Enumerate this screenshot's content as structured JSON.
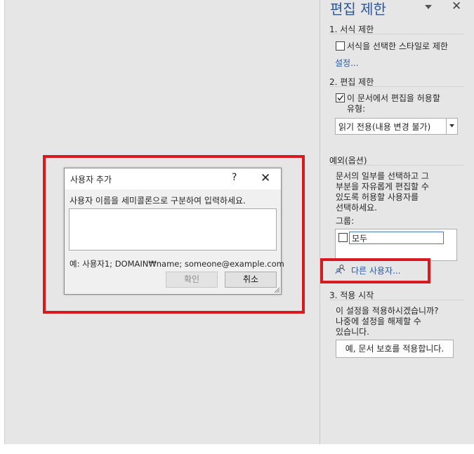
{
  "colors": {
    "accent": "#2b579a",
    "highlight_red": "#d61a1f",
    "pane_bg": "#e6e6e6"
  },
  "pane": {
    "title": "편집 제한",
    "dropdown_icon": "chevron-down-icon",
    "close_icon": "close-icon",
    "section1": {
      "heading": "1. 서식 제한",
      "checkbox_label": "서식을 선택한 스타일로 제한",
      "checked": false,
      "settings_link": "설정..."
    },
    "section2": {
      "heading": "2. 편집 제한",
      "checkbox_label_line1": "이 문서에서 편집을 허용할",
      "checkbox_label_line2": "유형:",
      "checked": true,
      "select_value": "읽기 전용(내용 변경 불가)"
    },
    "exceptions": {
      "heading": "예외(옵션)",
      "desc_lines": [
        "문서의 일부를 선택하고 그",
        "부분을 자유롭게 편집할 수",
        "있도록 허용할 사용자를",
        "선택하세요."
      ],
      "group_label": "그룹:",
      "group_item": "모두",
      "group_item_checked": false,
      "more_users_link": "다른 사용자..."
    },
    "section3": {
      "heading": "3. 적용 시작",
      "desc_lines": [
        "이 설정을 적용하시겠습니까?",
        "나중에 설정을 해제할 수",
        "있습니다."
      ],
      "apply_button": "예, 문서 보호를 적용합니다."
    }
  },
  "dialog": {
    "title": "사용자 추가",
    "help": "?",
    "close": "✕",
    "prompt": "사용자 이름을 세미콜론으로 구분하여 입력하세요.",
    "input_value": "",
    "example": "예: 사용자1; DOMAIN₩name; someone@example.com",
    "ok_label": "확인",
    "cancel_label": "취소"
  }
}
